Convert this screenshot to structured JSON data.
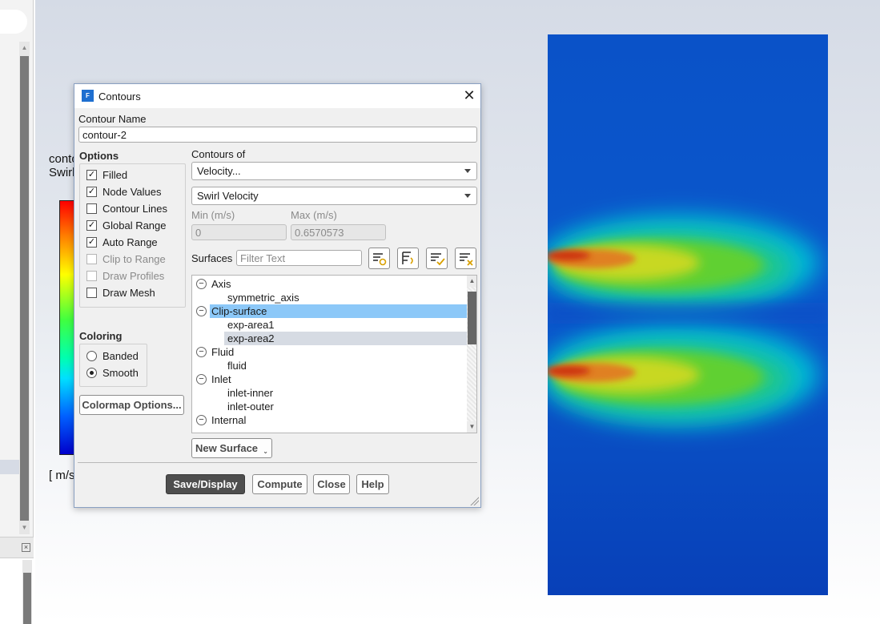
{
  "graphics": {
    "legend_title_line1": "conto",
    "legend_title_line2": "Swirl",
    "legend_unit": "[ m/s"
  },
  "dialog": {
    "title": "Contours",
    "contour_name_label": "Contour Name",
    "contour_name_value": "contour-2",
    "options_heading": "Options",
    "options": [
      {
        "label": "Filled",
        "checked": true,
        "enabled": true
      },
      {
        "label": "Node Values",
        "checked": true,
        "enabled": true
      },
      {
        "label": "Contour Lines",
        "checked": false,
        "enabled": true
      },
      {
        "label": "Global Range",
        "checked": true,
        "enabled": true
      },
      {
        "label": "Auto Range",
        "checked": true,
        "enabled": true
      },
      {
        "label": "Clip to Range",
        "checked": false,
        "enabled": false
      },
      {
        "label": "Draw Profiles",
        "checked": false,
        "enabled": false
      },
      {
        "label": "Draw Mesh",
        "checked": false,
        "enabled": true
      }
    ],
    "coloring_heading": "Coloring",
    "coloring": [
      {
        "label": "Banded",
        "selected": false
      },
      {
        "label": "Smooth",
        "selected": true
      }
    ],
    "colormap_button": "Colormap Options...",
    "contours_of_label": "Contours of",
    "contours_of_value": "Velocity...",
    "contours_sub_value": "Swirl Velocity",
    "min_label": "Min (m/s)",
    "max_label": "Max (m/s)",
    "min_value": "0",
    "max_value": "0.6570573",
    "surfaces_label": "Surfaces",
    "filter_placeholder": "Filter Text",
    "surface_tools": [
      "filter-new-icon",
      "filter-flip-icon",
      "select-all-icon",
      "deselect-all-icon"
    ],
    "surfaces": [
      {
        "label": "Axis",
        "type": "group"
      },
      {
        "label": "symmetric_axis",
        "type": "item"
      },
      {
        "label": "Clip-surface",
        "type": "group",
        "selected": true
      },
      {
        "label": "exp-area1",
        "type": "item"
      },
      {
        "label": "exp-area2",
        "type": "item",
        "hover": true
      },
      {
        "label": "Fluid",
        "type": "group"
      },
      {
        "label": "fluid",
        "type": "item"
      },
      {
        "label": "Inlet",
        "type": "group"
      },
      {
        "label": "inlet-inner",
        "type": "item"
      },
      {
        "label": "inlet-outer",
        "type": "item"
      },
      {
        "label": "Internal",
        "type": "group"
      }
    ],
    "new_surface_button": "New Surface",
    "buttons": {
      "save_display": "Save/Display",
      "compute": "Compute",
      "close": "Close",
      "help": "Help"
    }
  },
  "colors": {
    "selection": "#8cc8f8",
    "hover": "#d6dbe3",
    "primary_button": "#4e4e4e"
  }
}
